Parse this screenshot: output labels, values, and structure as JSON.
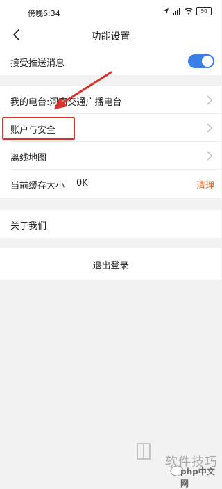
{
  "status_bar": {
    "time": "傍晚6:34",
    "battery": "90"
  },
  "nav": {
    "title": "功能设置"
  },
  "settings": {
    "push": {
      "label": "接受推送消息",
      "toggle_on": true
    },
    "station": {
      "label": "我的电台:河南交通广播电台"
    },
    "account": {
      "label": "账户与安全"
    },
    "offline_map": {
      "label": "离线地图"
    },
    "cache": {
      "label": "当前缓存大小",
      "value": "0K",
      "action": "清理"
    },
    "about": {
      "label": "关于我们"
    }
  },
  "logout": {
    "label": "退出登录"
  },
  "watermark": {
    "text": "软件技巧",
    "site": "php中文网"
  },
  "colors": {
    "accent": "#3c7fe6",
    "clear_action": "#e0662d",
    "annotation": "#d9322b"
  }
}
